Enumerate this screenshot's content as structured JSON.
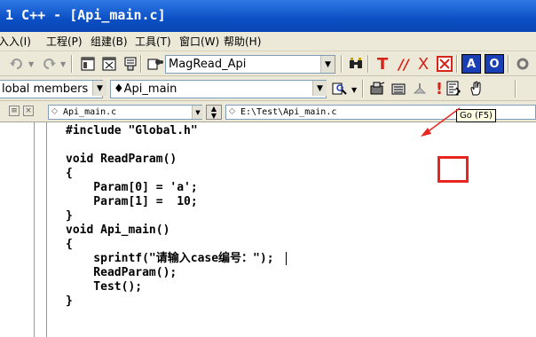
{
  "window": {
    "title": "1 C++ - [Api_main.c]"
  },
  "menu": {
    "items": [
      "入入(I)",
      "工程(P)",
      "组建(B)",
      "工具(T)",
      "窗口(W)",
      "帮助(H)"
    ]
  },
  "toolbar1": {
    "find_combo_value": "MagRead_Api",
    "icons": [
      "undo-icon",
      "redo-icon",
      "workspace-icon",
      "output-icon",
      "window-list-icon",
      "find-in-files-icon",
      "binoculars-icon",
      "t-icon",
      "comment-icon",
      "uncomment-icon",
      "close-box-icon",
      "a-box-icon",
      "o-box-icon"
    ],
    "t_glyph": "T",
    "comment_glyph": "//",
    "x_glyph": "X",
    "a_glyph": "A",
    "o_glyph": "O",
    "colors": {
      "red": "#d62418",
      "blue": "#1a3fb5"
    }
  },
  "toolbar2": {
    "members_combo": "lobal members",
    "function_combo": "♦Api_main",
    "go_tooltip": "Go (F5)"
  },
  "editor_header": {
    "file_combo": "Api_main.c",
    "path_combo": "E:\\Test\\Api_main.c"
  },
  "code": {
    "lines": [
      "#include \"Global.h\"",
      "",
      "void ReadParam()",
      "{",
      "    Param[0] = 'a';",
      "    Param[1] =  10;",
      "}",
      "void Api_main()",
      "{",
      "    sprintf(\"请输入case编号：\");",
      "    ReadParam();",
      "    Test();",
      "}"
    ]
  }
}
